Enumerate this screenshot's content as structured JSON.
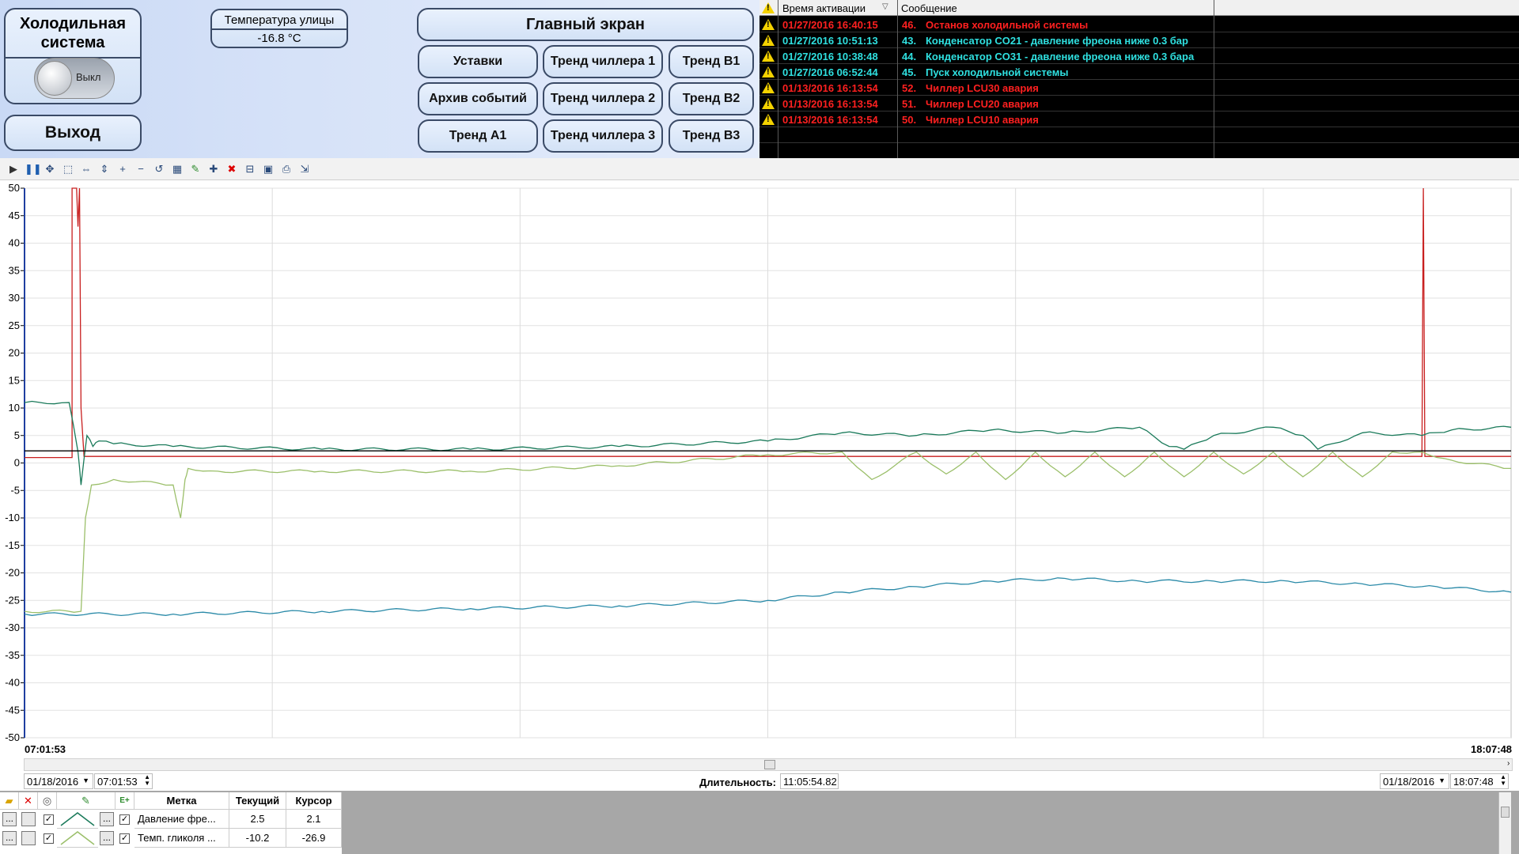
{
  "system": {
    "title": "Холодильная\nсистема",
    "toggle_label": "Выкл"
  },
  "street": {
    "title": "Температура улицы",
    "value": "-16.8 °C"
  },
  "buttons": {
    "exit": "Выход",
    "main_screen": "Главный экран",
    "settings": "Уставки",
    "chiller_trend_1": "Тренд чиллера 1",
    "trend_b1": "Тренд B1",
    "event_archive": "Архив событий",
    "chiller_trend_2": "Тренд чиллера 2",
    "trend_b2": "Тренд B2",
    "trend_a1": "Тренд A1",
    "chiller_trend_3": "Тренд чиллера 3",
    "trend_b3": "Тренд B3"
  },
  "alarms": {
    "header": {
      "time": "Время активации",
      "message": "Сообщение"
    },
    "rows": [
      {
        "time": "01/27/2016 16:40:15",
        "num": "46.",
        "message": "Останов холодильной системы",
        "color": "#ff2020"
      },
      {
        "time": "01/27/2016 10:51:13",
        "num": "43.",
        "message": "Конденсатор CO21 - давление фреона ниже 0.3 бар",
        "color": "#2fe0e0"
      },
      {
        "time": "01/27/2016 10:38:48",
        "num": "44.",
        "message": "Конденсатор CO31 - давление фреона ниже 0.3 бара",
        "color": "#2fe0e0"
      },
      {
        "time": "01/27/2016 06:52:44",
        "num": "45.",
        "message": "Пуск холодильной системы",
        "color": "#2fe0e0"
      },
      {
        "time": "01/13/2016 16:13:54",
        "num": "52.",
        "message": "Чиллер LCU30 авария",
        "color": "#ff2020"
      },
      {
        "time": "01/13/2016 16:13:54",
        "num": "51.",
        "message": "Чиллер LCU20 авария",
        "color": "#ff2020"
      },
      {
        "time": "01/13/2016 16:13:54",
        "num": "50.",
        "message": "Чиллер LCU10 авария",
        "color": "#ff2020"
      }
    ]
  },
  "toolbar_icons": [
    "play-icon",
    "pause-icon",
    "pan-icon",
    "zoom-area-icon",
    "zoom-time-icon",
    "zoom-value-icon",
    "zoom-in-icon",
    "zoom-out-icon",
    "zoom-reset-icon",
    "table-icon",
    "pen-edit-icon",
    "add-pen-icon",
    "delete-pen-icon",
    "ruler-icon",
    "layout-icon",
    "print-icon",
    "export-icon"
  ],
  "chart_data": {
    "type": "line",
    "ylim": [
      -50,
      50
    ],
    "y_ticks": [
      "50",
      "45",
      "40",
      "35",
      "30",
      "25",
      "20",
      "15",
      "10",
      "5",
      "0",
      "-5",
      "-10",
      "-15",
      "-20",
      "-25",
      "-30",
      "-35",
      "-40",
      "-45",
      "-50"
    ],
    "x_range": [
      "07:01:53",
      "18:07:48"
    ],
    "series": [
      {
        "color": "#c81e1e",
        "x": [
          0,
          0.032,
          0.032,
          0.035,
          0.036,
          0.037,
          0.038,
          0.04,
          0.94,
          0.941,
          0.942,
          1.0
        ],
        "values": [
          1,
          1,
          50,
          50,
          43,
          50,
          10,
          1.2,
          1.2,
          50,
          1.2,
          1.2
        ]
      },
      {
        "color": "#1a7a5a",
        "x": [
          0,
          0.03,
          0.036,
          0.038,
          0.042,
          0.046,
          0.05,
          0.06,
          0.1,
          0.2,
          0.3,
          0.4,
          0.5,
          0.55,
          0.6,
          0.65,
          0.7,
          0.75,
          0.77,
          0.78,
          0.8,
          0.84,
          0.86,
          0.87,
          0.9,
          0.94,
          0.96,
          1.0
        ],
        "values": [
          11,
          11,
          2,
          -4,
          5,
          3,
          4,
          3.5,
          3,
          2.5,
          2.5,
          3,
          4,
          5.5,
          5,
          6,
          5.5,
          6.5,
          3,
          2.5,
          5,
          6.5,
          5,
          2.5,
          5.5,
          5,
          6,
          6.5
        ]
      },
      {
        "color": "#000000",
        "x": [
          0,
          1.0
        ],
        "values": [
          2.2,
          2.2
        ]
      },
      {
        "color": "#9bbf6a",
        "x": [
          0,
          0.038,
          0.041,
          0.045,
          0.06,
          0.1,
          0.105,
          0.108,
          0.11,
          0.13,
          0.2,
          0.3,
          0.4,
          0.5,
          0.55,
          0.57,
          0.6,
          0.62,
          0.64,
          0.66,
          0.68,
          0.7,
          0.72,
          0.74,
          0.76,
          0.78,
          0.8,
          0.82,
          0.84,
          0.86,
          0.88,
          0.9,
          0.92,
          0.94,
          0.96,
          1.0
        ],
        "values": [
          -27,
          -27,
          -10,
          -4,
          -3,
          -4,
          -10,
          -3,
          -1,
          -1.5,
          -1.5,
          -1.5,
          -0.5,
          1.5,
          2,
          -3,
          2,
          -2,
          2,
          -3,
          2,
          -2.5,
          2,
          -2.5,
          2,
          -2.5,
          2,
          -2,
          2,
          -2.5,
          2,
          -2.5,
          2,
          2,
          0.5,
          -1
        ]
      },
      {
        "color": "#2a8aa8",
        "x": [
          0,
          0.1,
          0.2,
          0.3,
          0.4,
          0.5,
          0.55,
          0.6,
          0.65,
          0.7,
          0.75,
          0.8,
          0.85,
          0.9,
          0.95,
          1.0
        ],
        "values": [
          -27.5,
          -27.5,
          -27,
          -26.5,
          -26,
          -25,
          -23.5,
          -22.5,
          -21.5,
          -21,
          -21.5,
          -21.5,
          -21.5,
          -22,
          -22.5,
          -23.5
        ]
      }
    ]
  },
  "range": {
    "start_date": "01/18/2016",
    "start_time": "07:01:53",
    "duration_label": "Длительность:",
    "duration": "11:05:54.82",
    "end_date": "01/18/2016",
    "end_time": "18:07:48"
  },
  "pens": {
    "headers": {
      "tag": "Метка",
      "current": "Текущий",
      "cursor": "Курсор"
    },
    "rows": [
      {
        "tag": "Давление фре...",
        "current": "2.5",
        "cursor": "2.1"
      },
      {
        "tag": "Темп. гликоля ...",
        "current": "-10.2",
        "cursor": "-26.9"
      }
    ]
  }
}
